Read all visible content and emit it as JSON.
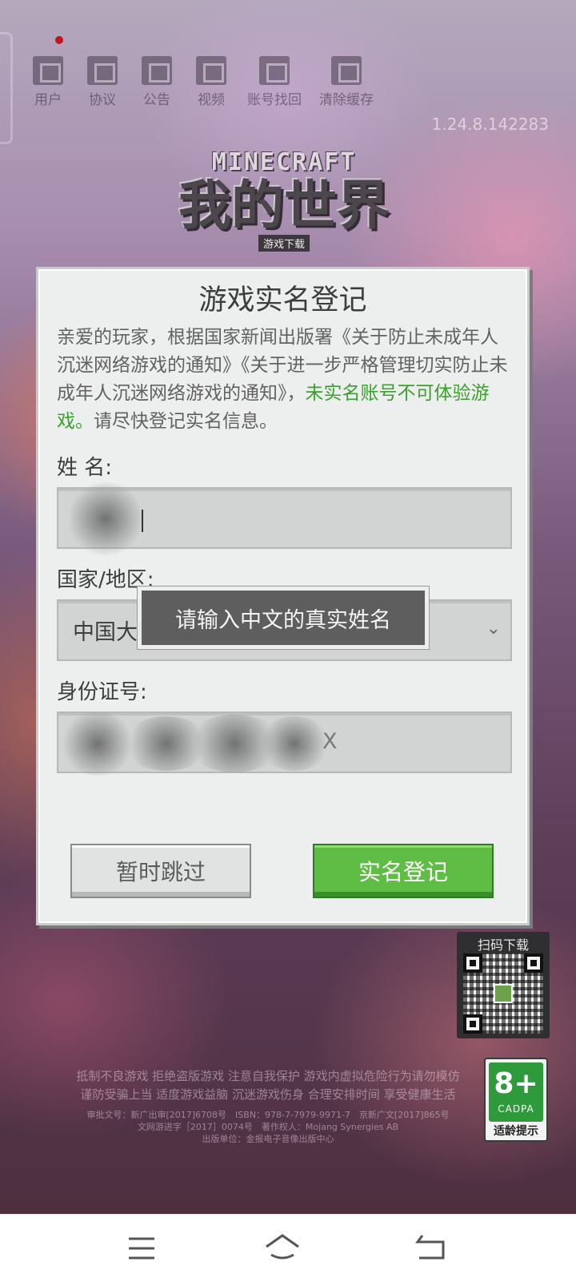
{
  "top_menu": [
    {
      "label": "用户",
      "icon": "user-icon"
    },
    {
      "label": "协议",
      "icon": "agreement-icon"
    },
    {
      "label": "公告",
      "icon": "announcement-icon"
    },
    {
      "label": "视频",
      "icon": "video-icon"
    },
    {
      "label": "账号找回",
      "icon": "account-recovery-icon"
    },
    {
      "label": "清除缓存",
      "icon": "clear-cache-icon"
    }
  ],
  "version": "1.24.8.142283",
  "logo": {
    "top": "MINECRAFT",
    "main": "我的世界",
    "sub": "游戏下载"
  },
  "dialog": {
    "title": "游戏实名登记",
    "notice_part1": "亲爱的玩家，根据国家新闻出版署《关于防止未成年人沉迷网络游戏的通知》《关于进一步严格管理切实防止未成年人沉迷网络游戏的通知》，",
    "notice_highlight": "未实名账号不可体验游戏。",
    "notice_part2": "请尽快登记实名信息。",
    "name_label": "姓 名:",
    "region_label": "国家/地区:",
    "region_value": "中国大陆",
    "id_label": "身份证号:",
    "id_visible_tail": "X",
    "skip_button": "暂时跳过",
    "register_button": "实名登记"
  },
  "toast": "请输入中文的真实姓名",
  "qr": {
    "title": "扫码下载"
  },
  "footer": {
    "line1": "抵制不良游戏 拒绝盗版游戏 注意自我保护 游戏内虚拟危险行为请勿模仿",
    "line2": "谨防受骗上当 适度游戏益脑 沉迷游戏伤身 合理安排时间 享受健康生活",
    "line3": "审批文号：新广出审[2017]6708号　ISBN：978-7-7979-9971-7　京新广文[2017]865号",
    "line4": "文网游进字［2017］0074号　著作权人：Mojang Synergies AB",
    "line5": "出版单位：金报电子音像出版中心"
  },
  "age_rating": {
    "number": "8+",
    "org": "CADPA",
    "label": "适龄提示"
  },
  "colors": {
    "accent_green": "#3aa12f",
    "button_green": "#5fbd45"
  }
}
